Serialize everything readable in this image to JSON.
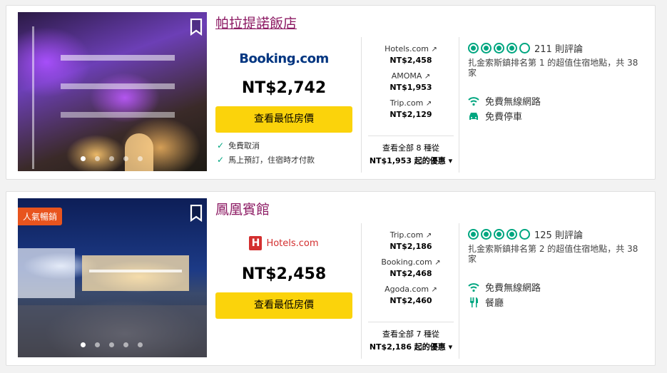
{
  "hotels": [
    {
      "name": "帕拉提諾飯店",
      "featured_provider": "Booking.com",
      "featured_price": "NT$2,742",
      "cta_label": "查看最低房價",
      "perks": [
        "免費取消",
        "馬上預訂，住宿時才付款"
      ],
      "offers": [
        {
          "provider": "Hotels.com",
          "price": "NT$2,458"
        },
        {
          "provider": "AMOMA",
          "price": "NT$1,953"
        },
        {
          "provider": "Trip.com",
          "price": "NT$2,129"
        }
      ],
      "all_deals_line1": "查看全部 8 種從",
      "all_deals_line2": "NT$1,953 起的優惠",
      "rating_bubbles": 4,
      "review_count": "211 則評論",
      "rank": "扎金索斯鎮排名第 1 的超值住宿地點，共 38 家",
      "amenities": [
        {
          "icon": "wifi-icon",
          "label": "免費無線網路"
        },
        {
          "icon": "car-icon",
          "label": "免費停車"
        }
      ]
    },
    {
      "badge": "人氣暢銷",
      "name": "鳳凰賓館",
      "featured_provider": "Hotels.com",
      "featured_price": "NT$2,458",
      "cta_label": "查看最低房價",
      "offers": [
        {
          "provider": "Trip.com",
          "price": "NT$2,186"
        },
        {
          "provider": "Booking.com",
          "price": "NT$2,468"
        },
        {
          "provider": "Agoda.com",
          "price": "NT$2,460"
        }
      ],
      "all_deals_line1": "查看全部 7 種從",
      "all_deals_line2": "NT$2,186 起的優惠",
      "rating_bubbles": 4,
      "review_count": "125 則評論",
      "rank": "扎金索斯鎮排名第 2 的超值住宿地點，共 38 家",
      "amenities": [
        {
          "icon": "wifi-icon",
          "label": "免費無線網路"
        },
        {
          "icon": "restaurant-icon",
          "label": "餐廳"
        }
      ]
    }
  ],
  "colors": {
    "accent_green": "#00a680",
    "cta_yellow": "#fbd30b",
    "hotel_name": "#8c1a63",
    "badge": "#e8541e"
  }
}
